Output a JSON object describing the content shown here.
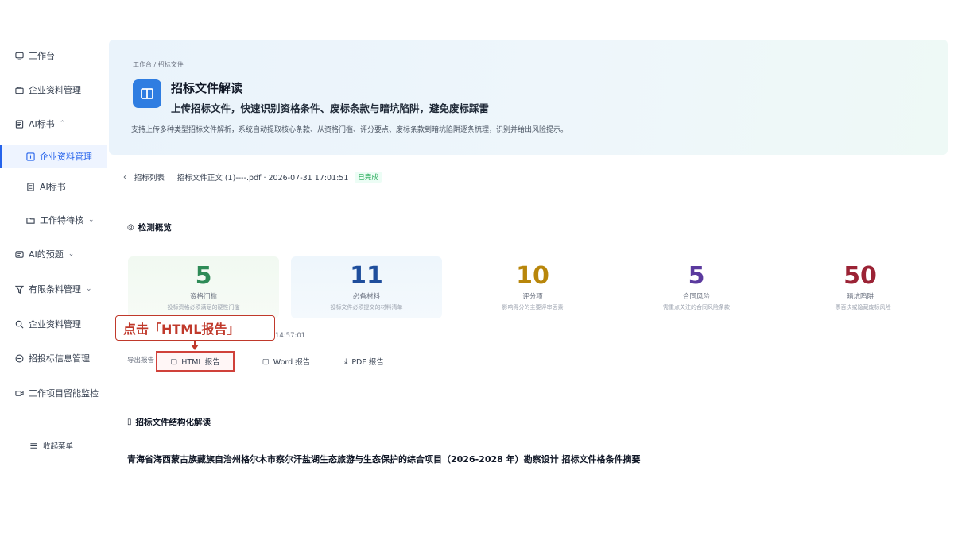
{
  "sidebar": {
    "items": [
      {
        "label": "工作台",
        "icon": "monitor-icon"
      },
      {
        "label": "企业资料管理",
        "icon": "briefcase-icon"
      },
      {
        "label": "AI标书",
        "icon": "document-icon",
        "expanded": true
      },
      {
        "label": "企业资料管理",
        "icon": "info-icon",
        "active": true
      },
      {
        "label": "AI标书",
        "icon": "file-icon"
      },
      {
        "label": "工作特待核",
        "icon": "folder-icon"
      },
      {
        "label": "AI的预题",
        "icon": "screen-icon"
      },
      {
        "label": "有限条料管理",
        "icon": "filter-icon"
      },
      {
        "label": "企业资料管理",
        "icon": "search-icon"
      },
      {
        "label": "招投标信息管理",
        "icon": "minus-circle-icon"
      },
      {
        "label": "工作项目留能监检",
        "icon": "video-icon"
      },
      {
        "label": "收起菜单",
        "icon": "menu-icon"
      }
    ]
  },
  "header": {
    "breadcrumb": "工作台 / 招标文件",
    "title": "招标文件解读",
    "subtitle": "上传招标文件，快速识别资格条件、废标条款与暗坑陷阱，避免废标踩雷",
    "description": "支持上传多种类型招标文件解析，系统自动提取核心条款、从资格门槛、评分要点、废标条款到暗坑陷阱逐条梳理，识别并给出风险提示。"
  },
  "file_bar": {
    "back_label": "招标列表",
    "file_name": "招标文件正文 (1)----.pdf · 2026-07-31 17:01:51",
    "status": "已完成"
  },
  "overview": {
    "title": "检测概览",
    "stats": [
      {
        "value": "5",
        "label": "资格门槛",
        "desc": "投标资格必须满足的硬性门槛",
        "color": "#2e8b57"
      },
      {
        "value": "11",
        "label": "必备材料",
        "desc": "投标文件必须提交的材料清单",
        "color": "#1f4e9c"
      },
      {
        "value": "10",
        "label": "评分项",
        "desc": "影响得分的主要评审因素",
        "color": "#b8860b"
      },
      {
        "value": "5",
        "label": "合同风险",
        "desc": "需重点关注的合同风险条款",
        "color": "#5b3a9e"
      },
      {
        "value": "50",
        "label": "暗坑陷阱",
        "desc": "一票否决或隐藏废标风险",
        "color": "#9b2335"
      }
    ]
  },
  "callout": {
    "text": "点击「HTML报告」"
  },
  "report": {
    "time_fragment": "14:57:01",
    "label": "导出报告",
    "buttons": [
      {
        "label": "HTML 报告",
        "icon": "file-icon"
      },
      {
        "label": "Word 报告",
        "icon": "word-icon"
      },
      {
        "label": "PDF 报告",
        "icon": "download-icon"
      }
    ]
  },
  "structured": {
    "title": "招标文件结构化解读",
    "doc_heading": "青海省海西蒙古族藏族自治州格尔木市察尔汗盐湖生态旅游与生态保护的综合项目（2026-2028 年）勘察设计 招标文件格条件摘要"
  }
}
